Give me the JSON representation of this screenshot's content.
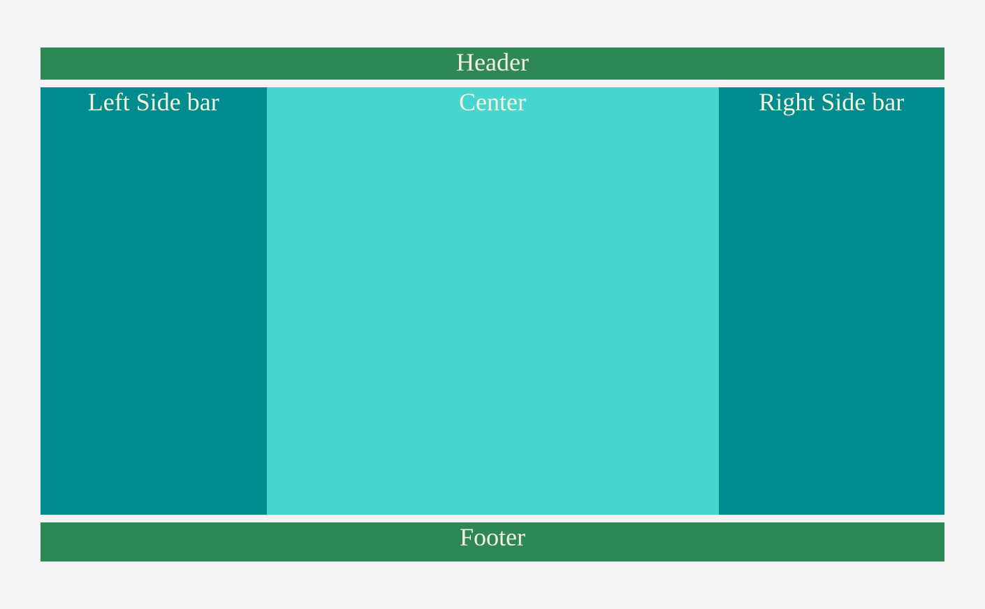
{
  "header": {
    "label": "Header"
  },
  "left_sidebar": {
    "label": "Left Side bar"
  },
  "center": {
    "label": "Center"
  },
  "right_sidebar": {
    "label": "Right Side bar"
  },
  "footer": {
    "label": "Footer"
  }
}
